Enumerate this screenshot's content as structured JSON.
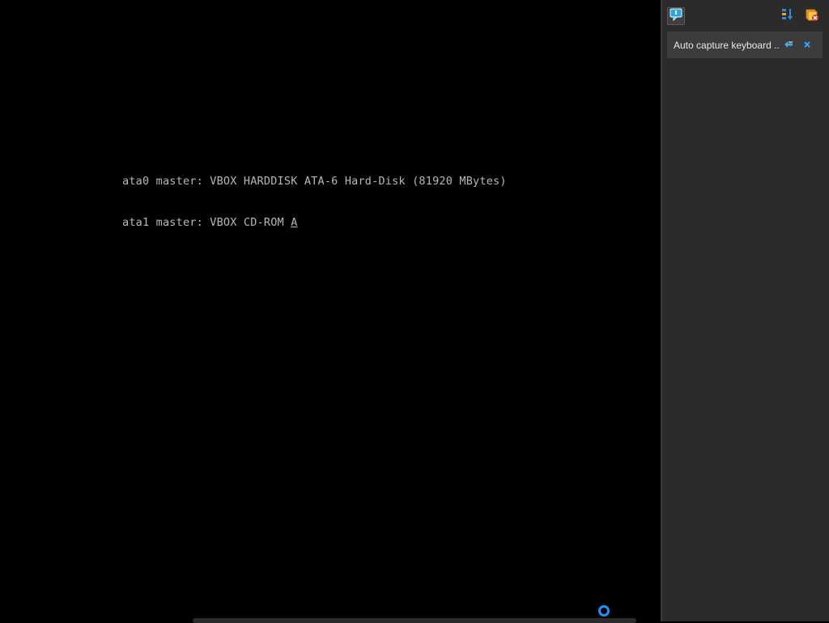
{
  "console": {
    "line1": "ata0 master: VBOX HARDDISK ATA-6 Hard-Disk (81920 MBytes)",
    "line2_prefix": "ata1 master: VBOX CD-ROM ",
    "line2_cursor": "A"
  },
  "notification_panel": {
    "toolbar": {
      "icons": [
        "notification-center-icon",
        "sort-icon",
        "clear-all-icon"
      ]
    },
    "items": [
      {
        "text": "Auto capture keyboard ...",
        "icons": [
          "toggle-details-icon",
          "close-icon"
        ]
      }
    ]
  },
  "colors": {
    "screen_bg": "#000000",
    "console_text": "#b8b8b8",
    "panel_bg": "#2b2b2b",
    "notification_bg": "#3c3c3c",
    "accent": "#1e90ff"
  }
}
